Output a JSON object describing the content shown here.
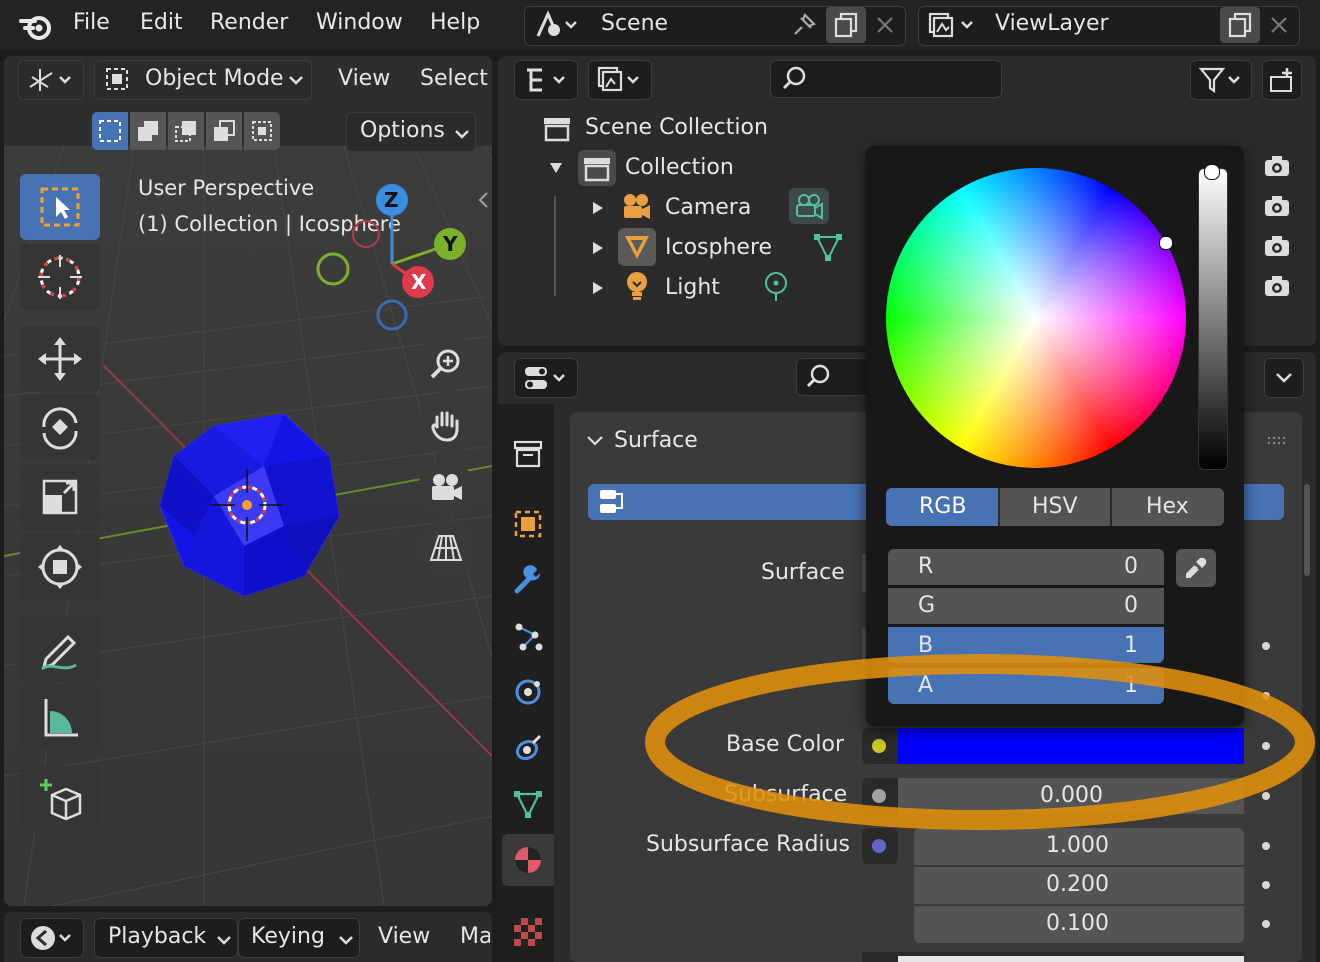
{
  "menubar": {
    "items": [
      "File",
      "Edit",
      "Render",
      "Window",
      "Help"
    ]
  },
  "scene": {
    "name": "Scene"
  },
  "viewlayer": {
    "name": "ViewLayer"
  },
  "viewport": {
    "mode": "Object Mode",
    "view": "View",
    "select": "Select",
    "options": "Options",
    "overlay_line1": "User Perspective",
    "overlay_line2": "(1) Collection | Icosphere",
    "axis_labels": {
      "z": "Z",
      "y": "Y",
      "x": "X"
    }
  },
  "timeline": {
    "items": [
      "Playback",
      "Keying",
      "View",
      "Ma"
    ]
  },
  "outliner": {
    "scene_collection": "Scene Collection",
    "collection": "Collection",
    "items": [
      {
        "label": "Camera"
      },
      {
        "label": "Icosphere"
      },
      {
        "label": "Light"
      }
    ]
  },
  "properties": {
    "panel_title": "Surface",
    "surface_label": "Surface",
    "base_color_label": "Base Color",
    "subsurface_label": "Subsurface",
    "subsurface_value": "0.000",
    "subsurface_radius_label": "Subsurface Radius",
    "radius_values": [
      "1.000",
      "0.200",
      "0.100"
    ]
  },
  "color_picker": {
    "tabs": [
      "RGB",
      "HSV",
      "Hex"
    ],
    "active_tab": "RGB",
    "channels": [
      {
        "label": "R",
        "value": "0"
      },
      {
        "label": "G",
        "value": "0"
      },
      {
        "label": "B",
        "value": "1"
      },
      {
        "label": "A",
        "value": "1"
      }
    ]
  },
  "colors": {
    "accent": "#4772b3",
    "base_color": "#0000ff",
    "highlight": "#e0900a"
  }
}
